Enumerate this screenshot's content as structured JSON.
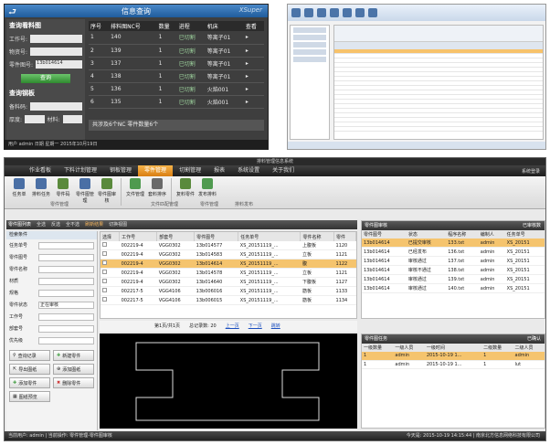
{
  "top_left": {
    "title": "信息查询",
    "brand": "XSuper",
    "left": {
      "section1": "查询看料图",
      "rows": [
        {
          "label": "工作号:",
          "value": ""
        },
        {
          "label": "物资号:",
          "value": ""
        },
        {
          "label": "零件图号:",
          "value": "13b014614"
        }
      ],
      "query_button": "查询",
      "section2": "查询钢板",
      "rows2": [
        {
          "label": "备料码:",
          "value": ""
        },
        {
          "label": "厚度:",
          "value": ""
        },
        {
          "label": "材料:",
          "value": ""
        }
      ]
    },
    "table": {
      "headers": [
        "序号",
        "排料图NC号",
        "数量",
        "进程",
        "机床",
        "查看"
      ],
      "rows": [
        [
          "1",
          "140",
          "1",
          "已切割",
          "等离子01"
        ],
        [
          "2",
          "139",
          "1",
          "已切割",
          "等离子01"
        ],
        [
          "3",
          "137",
          "1",
          "已切割",
          "等离子01"
        ],
        [
          "4",
          "138",
          "1",
          "已切割",
          "等离子01"
        ],
        [
          "5",
          "136",
          "1",
          "已切割",
          "火焰001"
        ],
        [
          "6",
          "135",
          "1",
          "已切割",
          "火焰001"
        ]
      ]
    },
    "footer": "共涉及6个NC 零件数量6个",
    "status": "用户 admin 日期 星期一 2015年10月19日"
  },
  "bottom": {
    "app_title": "排料管理信息系统",
    "menu": [
      "作业看板",
      "下料计划管理",
      "钢板管理",
      "零件管理",
      "切割管理",
      "报表",
      "系统设置",
      "关于我们"
    ],
    "menu_active": 3,
    "system_label": "系统登录",
    "ribbon": [
      {
        "label": "任务单",
        "color": "#4a6fa5"
      },
      {
        "label": "排料任务",
        "color": "#4a6fa5"
      },
      {
        "label": "零件码",
        "color": "#5a8a3c"
      },
      {
        "label": "零件图管理",
        "color": "#4a6fa5"
      },
      {
        "label": "零件图审核",
        "color": "#5a8a3c"
      },
      {
        "label": "文件管理",
        "color": "#4f9a4f"
      },
      {
        "label": "套料排序",
        "color": "#6a6a6a"
      },
      {
        "label": "复料零件",
        "color": "#5a8a3c"
      },
      {
        "label": "发布排料",
        "color": "#4f9a4f"
      }
    ],
    "ribbon_groups": [
      "零件管理",
      "文件匹配管理",
      "零件管理",
      "排料发布"
    ],
    "list_header": {
      "title": "零件图列表",
      "options": [
        "全选",
        "反选",
        "全不选",
        "刷新结果",
        "切换视图"
      ]
    },
    "form": {
      "caption": "检索条件",
      "fields": [
        {
          "label": "任务单号",
          "value": ""
        },
        {
          "label": "零件图号",
          "value": ""
        },
        {
          "label": "零件名称",
          "value": ""
        },
        {
          "label": "材质",
          "value": ""
        },
        {
          "label": "规格",
          "value": ""
        },
        {
          "label": "零件状态",
          "value": "正在审核"
        },
        {
          "label": "工作号",
          "value": ""
        },
        {
          "label": "部套号",
          "value": ""
        },
        {
          "label": "优先级",
          "value": ""
        }
      ],
      "buttons": [
        {
          "label": "查询记录"
        },
        {
          "label": "新建零件"
        },
        {
          "label": "导出图纸"
        },
        {
          "label": "添加图纸"
        },
        {
          "label": "添加零件"
        },
        {
          "label": "删除零件"
        },
        {
          "label": "图纸预览"
        }
      ]
    },
    "grid": {
      "headers": [
        "选择",
        "工作号",
        "部套号",
        "零件图号",
        "任务单号",
        "零件名称",
        "零件"
      ],
      "rows": [
        [
          "002219-4",
          "VGG0302",
          "13b014577",
          "XS_20151119_...",
          "上腹板",
          "1120"
        ],
        [
          "002219-4",
          "VGG0302",
          "13b014583",
          "XS_20151119_...",
          "立板",
          "1121"
        ],
        [
          "002219-4",
          "VGG0302",
          "13b014614",
          "XS_20151119_...",
          "腹",
          "1122"
        ],
        [
          "002219-4",
          "VGG0302",
          "13b014578",
          "XS_20151119_...",
          "立板",
          "1121"
        ],
        [
          "002219-4",
          "VGG0302",
          "13b014640",
          "XS_20151119_...",
          "下腹板",
          "1127"
        ],
        [
          "002217-5",
          "VGG4106",
          "13b006016",
          "XS_20151119_...",
          "筋板",
          "1133"
        ],
        [
          "002217-5",
          "VGG4106",
          "13b006015",
          "XS_20151119_...",
          "筋板",
          "1134"
        ]
      ],
      "selected_index": 2
    },
    "pager": {
      "page_text": "第1页/共1页",
      "record_text": "总记录数: 20",
      "prev": "上一页",
      "next": "下一页",
      "jump": "跳转"
    },
    "right_top": {
      "title": "零件图审核",
      "right_label": "已审核数",
      "headers": [
        "零件图号",
        "状态",
        "程序名称",
        "编制人",
        "任务单号"
      ],
      "rows": [
        [
          "13b014614",
          "已提交审核",
          "133.txt",
          "admin",
          "XS_20151"
        ],
        [
          "13b014614",
          "已经发布",
          "136.txt",
          "admin",
          "XS_20151"
        ],
        [
          "13b014614",
          "审核通过",
          "137.txt",
          "admin",
          "XS_20151"
        ],
        [
          "13b014614",
          "审核不通过",
          "138.txt",
          "admin",
          "XS_20151"
        ],
        [
          "13b014614",
          "审核通过",
          "139.txt",
          "admin",
          "XS_20151"
        ],
        [
          "13b014614",
          "审核通过",
          "140.txt",
          "admin",
          "XS_20151"
        ]
      ],
      "selected_index": 0
    },
    "right_bottom": {
      "title": "零件图任务",
      "right_label": "已确认",
      "headers": [
        "一级数量",
        "一级人员",
        "一级时间",
        "二级数量",
        "二级人员"
      ],
      "rows": [
        [
          "1",
          "admin",
          "2015-10-19 1...",
          "1",
          "admin"
        ],
        [
          "1",
          "admin",
          "2015-10-19 1...",
          "1",
          "lut"
        ]
      ],
      "selected_index": 0
    },
    "status": "当前用户: admin | 当前操作: 零件管理-零件图审核",
    "status_right": "今天是: 2015-10-19 14:15:44 | 南京北方信息网络科技有限公司"
  }
}
